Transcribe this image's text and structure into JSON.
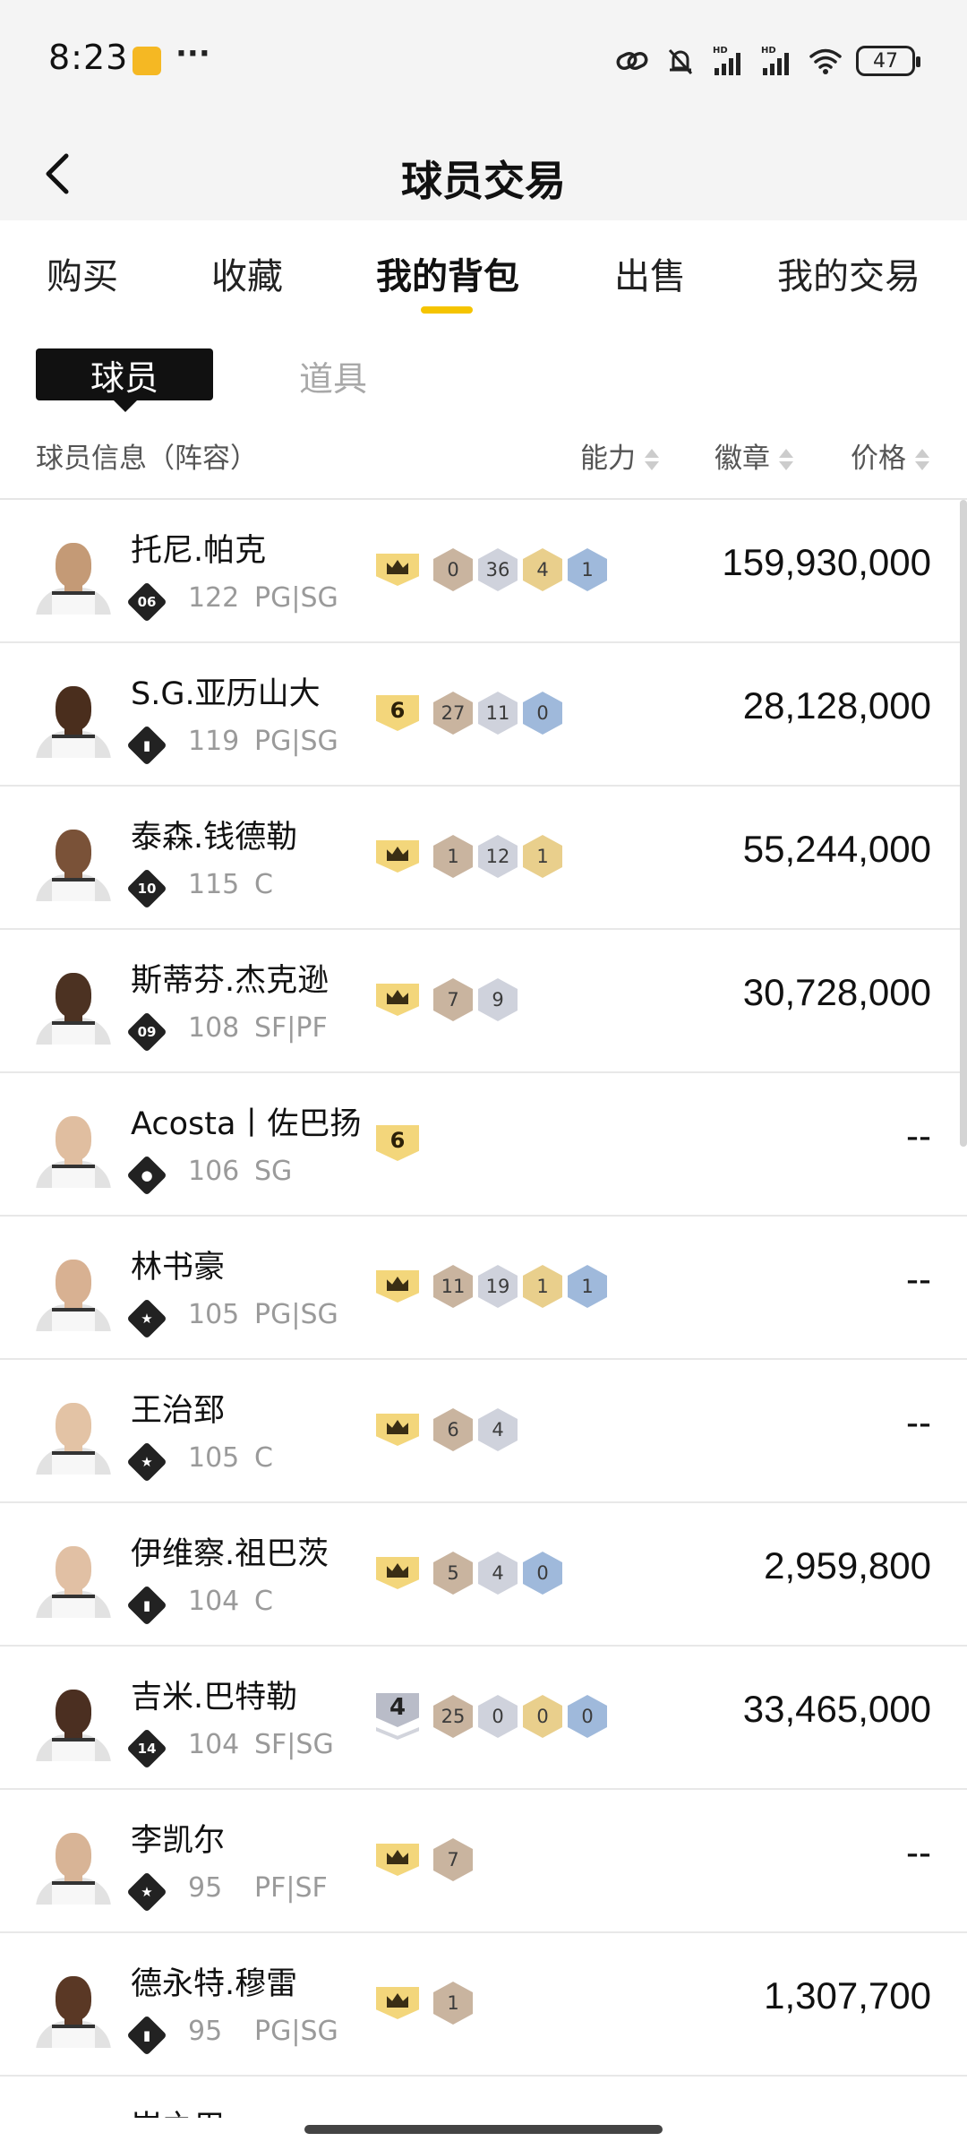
{
  "status_bar": {
    "time": "8:23",
    "dots": "···",
    "battery": "47"
  },
  "header": {
    "title": "球员交易"
  },
  "tabs": [
    {
      "label": "购买"
    },
    {
      "label": "收藏"
    },
    {
      "label": "我的背包"
    },
    {
      "label": "出售"
    },
    {
      "label": "我的交易"
    }
  ],
  "active_tab": "我的背包",
  "sub_tabs": {
    "players": "球员",
    "items": "道具"
  },
  "columns": {
    "info": "球员信息（阵容）",
    "ability": "能力",
    "badges": "徽章",
    "price": "价格"
  },
  "players": [
    {
      "name": "托尼.帕克",
      "tier": "06",
      "ability": "122",
      "position": "PG|SG",
      "lead": {
        "type": "crown"
      },
      "badges": [
        {
          "v": "0",
          "c": "bronze"
        },
        {
          "v": "36",
          "c": "silver"
        },
        {
          "v": "4",
          "c": "gold"
        },
        {
          "v": "1",
          "c": "blue"
        }
      ],
      "price": "159,930,000",
      "skin": "#c49a76"
    },
    {
      "name": "S.G.亚历山大",
      "tier": "bar",
      "ability": "119",
      "position": "PG|SG",
      "lead": {
        "type": "num",
        "v": "6"
      },
      "badges": [
        {
          "v": "27",
          "c": "bronze"
        },
        {
          "v": "11",
          "c": "silver"
        },
        {
          "v": "0",
          "c": "blue"
        }
      ],
      "price": "28,128,000",
      "skin": "#4a2e1d"
    },
    {
      "name": "泰森.钱德勒",
      "tier": "10",
      "ability": "115",
      "position": "C",
      "lead": {
        "type": "crown"
      },
      "badges": [
        {
          "v": "1",
          "c": "bronze"
        },
        {
          "v": "12",
          "c": "silver"
        },
        {
          "v": "1",
          "c": "gold"
        }
      ],
      "price": "55,244,000",
      "skin": "#7a5238"
    },
    {
      "name": "斯蒂芬.杰克逊",
      "tier": "09",
      "ability": "108",
      "position": "SF|PF",
      "lead": {
        "type": "crown"
      },
      "badges": [
        {
          "v": "7",
          "c": "bronze"
        },
        {
          "v": "9",
          "c": "silver"
        }
      ],
      "price": "30,728,000",
      "skin": "#4c3222"
    },
    {
      "name": "Acosta丨佐巴扬",
      "tier": "person",
      "ability": "106",
      "position": "SG",
      "lead": {
        "type": "num",
        "v": "6"
      },
      "badges": [],
      "price": "--",
      "skin": "#e0bea0"
    },
    {
      "name": "林书豪",
      "tier": "star",
      "ability": "105",
      "position": "PG|SG",
      "lead": {
        "type": "crown"
      },
      "badges": [
        {
          "v": "11",
          "c": "bronze"
        },
        {
          "v": "19",
          "c": "silver"
        },
        {
          "v": "1",
          "c": "gold"
        },
        {
          "v": "1",
          "c": "blue"
        }
      ],
      "price": "--",
      "skin": "#d8b192"
    },
    {
      "name": "王治郅",
      "tier": "star",
      "ability": "105",
      "position": "C",
      "lead": {
        "type": "crown"
      },
      "badges": [
        {
          "v": "6",
          "c": "bronze"
        },
        {
          "v": "4",
          "c": "silver"
        }
      ],
      "price": "--",
      "skin": "#e3c3a5"
    },
    {
      "name": "伊维察.祖巴茨",
      "tier": "bar",
      "ability": "104",
      "position": "C",
      "lead": {
        "type": "crown"
      },
      "badges": [
        {
          "v": "5",
          "c": "bronze"
        },
        {
          "v": "4",
          "c": "silver"
        },
        {
          "v": "0",
          "c": "blue"
        }
      ],
      "price": "2,959,800",
      "skin": "#e1c0a4"
    },
    {
      "name": "吉米.巴特勒",
      "tier": "14",
      "ability": "104",
      "position": "SF|SG",
      "lead": {
        "type": "silver",
        "v": "4"
      },
      "badges": [
        {
          "v": "25",
          "c": "bronze"
        },
        {
          "v": "0",
          "c": "silver"
        },
        {
          "v": "0",
          "c": "gold"
        },
        {
          "v": "0",
          "c": "blue"
        }
      ],
      "price": "33,465,000",
      "skin": "#4b2f21"
    },
    {
      "name": "李凯尔",
      "tier": "star",
      "ability": "95",
      "position": "PF|SF",
      "lead": {
        "type": "crown"
      },
      "badges": [
        {
          "v": "7",
          "c": "bronze"
        }
      ],
      "price": "--",
      "skin": "#d8b496"
    },
    {
      "name": "德永特.穆雷",
      "tier": "bar",
      "ability": "95",
      "position": "PG|SG",
      "lead": {
        "type": "crown"
      },
      "badges": [
        {
          "v": "1",
          "c": "bronze"
        }
      ],
      "price": "1,307,700",
      "skin": "#5a3825"
    }
  ],
  "partial_row_text": "岸之用"
}
